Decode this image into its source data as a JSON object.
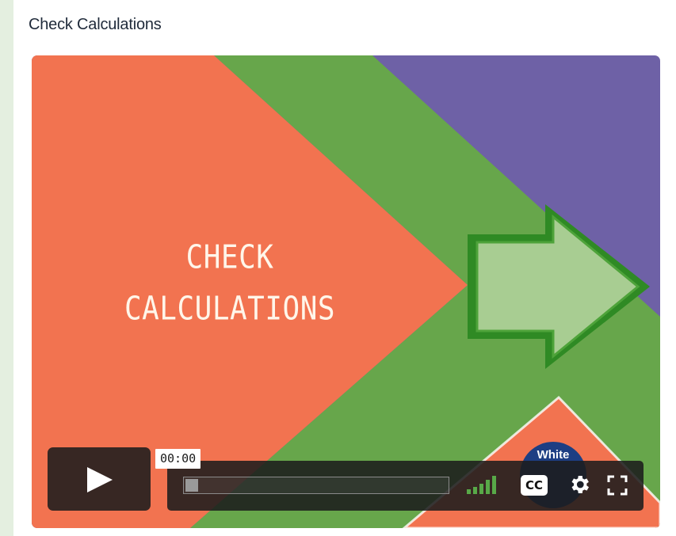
{
  "page": {
    "title": "Check Calculations"
  },
  "video": {
    "headline_line1": "CHECK",
    "headline_line2": "CALCULATIONS",
    "badge_text": "White",
    "colors": {
      "orange": "#f27350",
      "green": "#67a64b",
      "purple": "#6e61a6",
      "arrow_fill": "#a8cd92",
      "arrow_border": "#3f9a2f"
    }
  },
  "player": {
    "play_icon": "play-icon",
    "timecode": "00:00",
    "progress_fraction": 0,
    "volume_icon": "volume-bars-icon",
    "cc_label": "CC",
    "settings_icon": "gear-icon",
    "fullscreen_icon": "fullscreen-icon"
  }
}
